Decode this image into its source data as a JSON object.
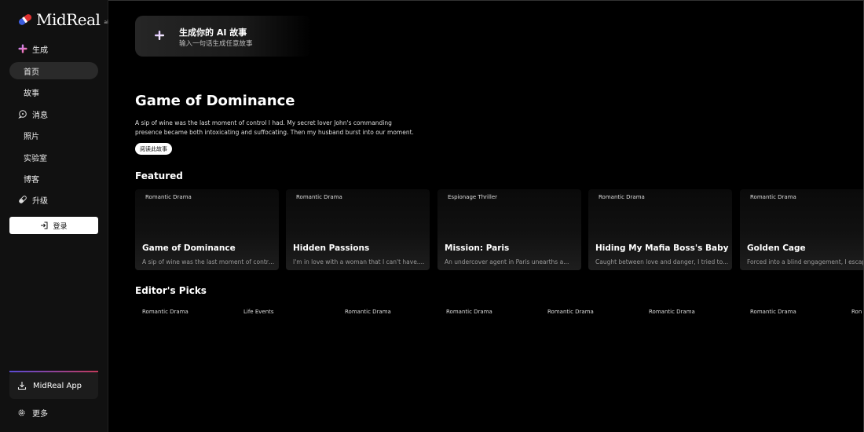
{
  "brand": {
    "name": "MidReal",
    "sup": "ai"
  },
  "sidebar": {
    "create_label": "生成",
    "items": [
      {
        "label": "首页",
        "active": true
      },
      {
        "label": "故事"
      },
      {
        "label": "消息"
      },
      {
        "label": "照片"
      },
      {
        "label": "实验室"
      },
      {
        "label": "博客"
      },
      {
        "label": "升级"
      }
    ],
    "login_label": "登录",
    "app_label": "MidReal App",
    "more_label": "更多"
  },
  "create_card": {
    "title": "生成你的 AI 故事",
    "subtitle": "输入一句话生成任意故事"
  },
  "hero": {
    "title": "Game of Dominance",
    "description": "A sip of wine was the last moment of control I had. My secret lover John's commanding presence became both intoxicating and suffocating. Then my husband burst into our moment.",
    "read_label": "阅读此故事"
  },
  "featured": {
    "title": "Featured",
    "cards": [
      {
        "genre": "Romantic Drama",
        "title": "Game of Dominance",
        "desc": "A sip of wine was the last moment of contro..."
      },
      {
        "genre": "Romantic Drama",
        "title": "Hidden Passions",
        "desc": "I'm in love with a woman that I can't have...."
      },
      {
        "genre": "Espionage Thriller",
        "title": "Mission: Paris",
        "desc": "An undercover agent in Paris unearths a..."
      },
      {
        "genre": "Romantic Drama",
        "title": "Hiding My Mafia Boss's Baby",
        "desc": "Caught between love and danger, I tried to..."
      },
      {
        "genre": "Romantic Drama",
        "title": "Golden Cage",
        "desc": "Forced into a blind engagement, I escape"
      }
    ]
  },
  "editors_picks": {
    "title": "Editor's Picks",
    "genres": [
      "Romantic Drama",
      "Life Events",
      "Romantic Drama",
      "Romantic Drama",
      "Romantic Drama",
      "Romantic Drama",
      "Romantic Drama",
      "Ron"
    ]
  }
}
